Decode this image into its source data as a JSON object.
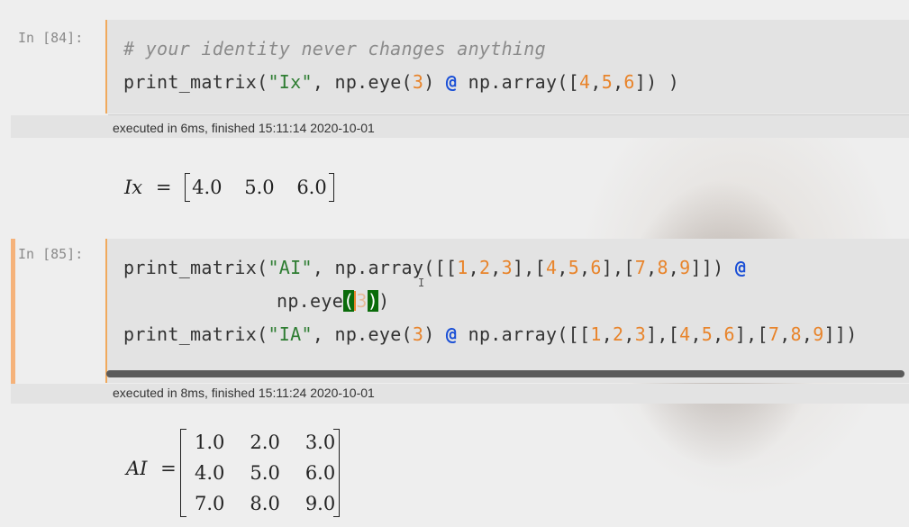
{
  "cells": [
    {
      "prompt": "In [84]:",
      "code": {
        "comment": "# your identity never changes anything",
        "line2": {
          "fn": "print_matrix(",
          "str": "\"Ix\"",
          "mid": ", np.eye(",
          "n3": "3",
          "mid2": ") ",
          "op": "@",
          "mid3": " np.array([",
          "n4": "4",
          "c1": ",",
          "n5": "5",
          "c2": ",",
          "n6": "6",
          "end": "]) )"
        }
      },
      "exec": "executed in 6ms, finished 15:11:14 2020-10-01",
      "output": {
        "lhs": "Ix",
        "eq": "=",
        "values": [
          "4.0",
          "5.0",
          "6.0"
        ]
      }
    },
    {
      "prompt": "In [85]:",
      "code": {
        "l1": {
          "fn": "print_matrix(",
          "str": "\"AI\"",
          "mid": ", np.array([[",
          "a": "1",
          "b": "2",
          "c": "3",
          "d": "4",
          "e": "5",
          "f": "6",
          "g": "7",
          "h": "8",
          "i": "9",
          "op": "@"
        },
        "l2": {
          "fn": "np.eye",
          "open": "(",
          "n3": "3",
          "close": ")",
          "tail": ")"
        },
        "l3": {
          "fn": "print_matrix(",
          "str": "\"IA\"",
          "mid": ", np.eye(",
          "n3": "3",
          "mid2": ") ",
          "op": "@",
          "mid3": " np.array([[",
          "a": "1",
          "b": "2",
          "c": "3",
          "d": "4",
          "e": "5",
          "f": "6",
          "g": "7",
          "h": "8",
          "i": "9",
          "end": "]])"
        }
      },
      "exec": "executed in 8ms, finished 15:11:24 2020-10-01",
      "output": {
        "lhs": "AI",
        "eq": "=",
        "rows": [
          [
            "1.0",
            "2.0",
            "3.0"
          ],
          [
            "4.0",
            "5.0",
            "6.0"
          ],
          [
            "7.0",
            "8.0",
            "9.0"
          ]
        ]
      }
    }
  ],
  "icons": {
    "text-cursor": "I-beam"
  },
  "colors": {
    "accent": "#f0a95c",
    "string": "#2e7d32",
    "number": "#e8842b",
    "operator": "#1a4fd6",
    "match_highlight": "#0a6b0a"
  }
}
